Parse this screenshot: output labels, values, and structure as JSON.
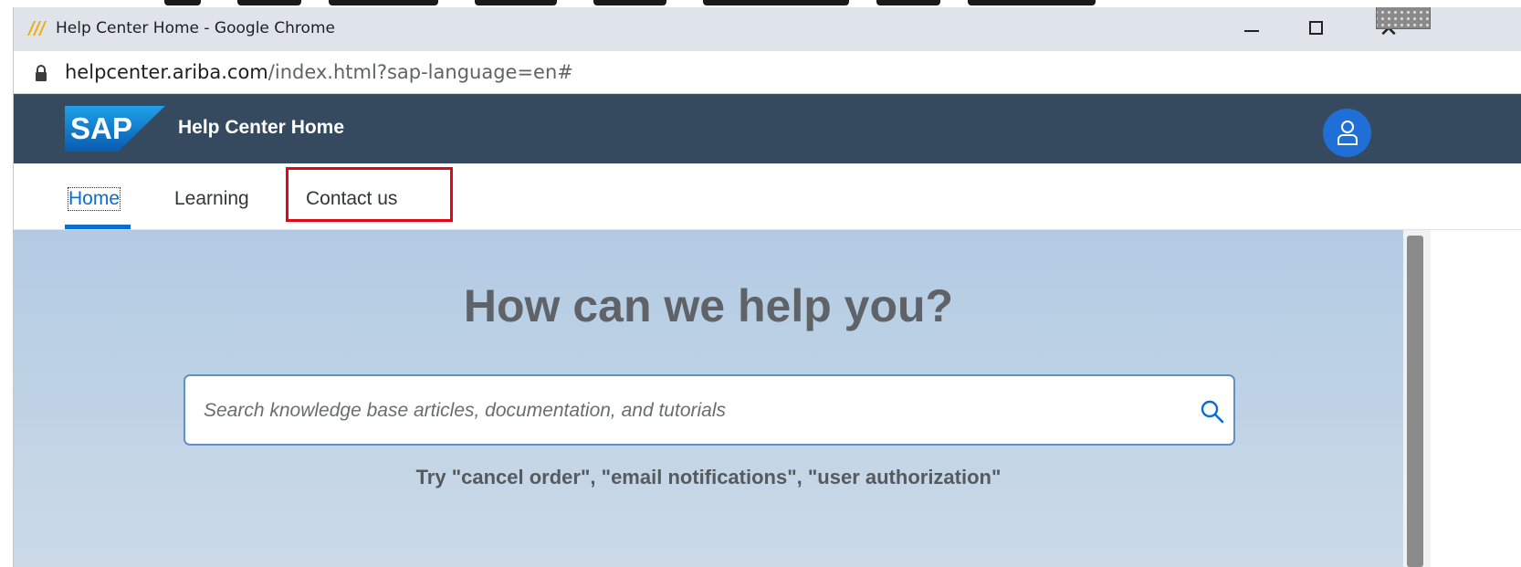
{
  "window": {
    "title": "Help Center Home - Google Chrome",
    "controls": [
      "minimize",
      "maximize",
      "close"
    ]
  },
  "address_bar": {
    "host": "helpcenter.ariba.com",
    "path": "/index.html?sap-language=en#"
  },
  "shell": {
    "logo_text": "SAP",
    "title": "Help Center Home",
    "brand_color": "#354a5f",
    "avatar_color": "#1f6fd6"
  },
  "tabs": [
    {
      "label": "Home",
      "selected": true
    },
    {
      "label": "Learning",
      "selected": false
    },
    {
      "label": "Contact us",
      "selected": false,
      "highlighted": true
    }
  ],
  "hero": {
    "heading": "How can we help you?",
    "search_placeholder": "Search knowledge base articles, documentation, and tutorials",
    "search_value": "",
    "hint": "Try  \"cancel order\", \"email notifications\", \"user authorization\""
  },
  "icons": {
    "app": "ariba-icon",
    "lock": "lock-icon",
    "avatar": "user-icon",
    "search": "search-icon"
  },
  "colors": {
    "accent": "#0a6ed1",
    "highlight": "#e30613"
  }
}
